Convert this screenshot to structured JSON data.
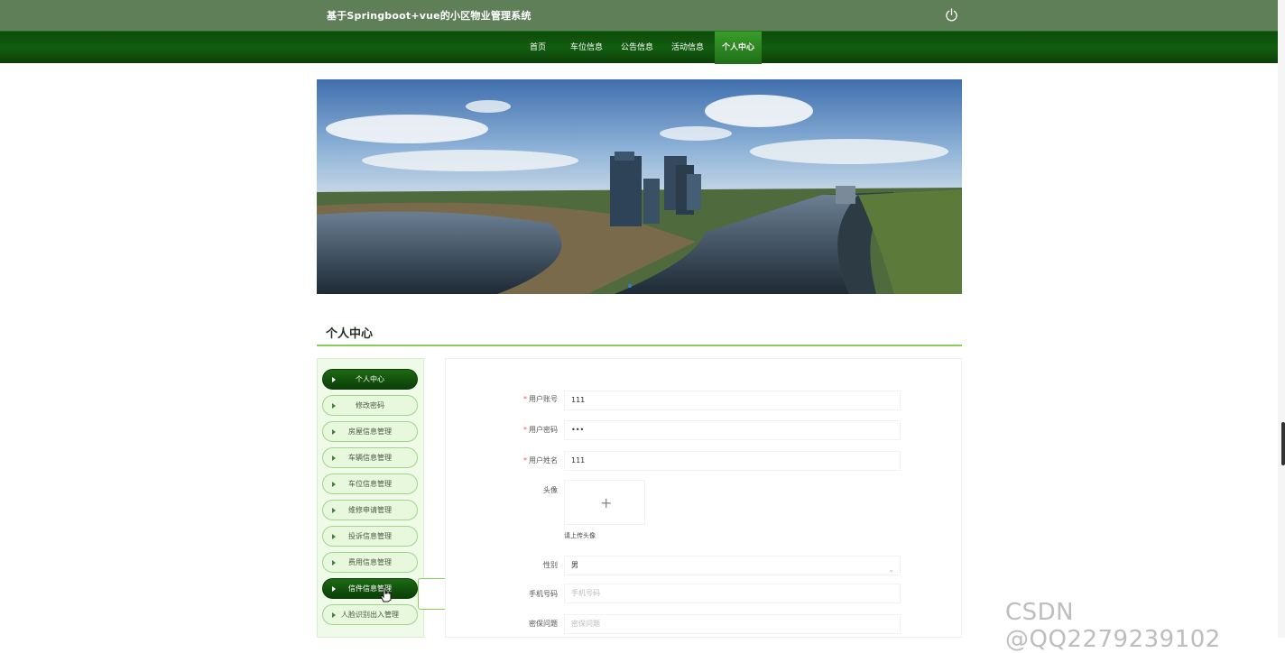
{
  "header": {
    "title": "基于Springboot+vue的小区物业管理系统",
    "power_icon": "power-icon"
  },
  "nav": {
    "items": [
      {
        "label": "首页"
      },
      {
        "label": "车位信息"
      },
      {
        "label": "公告信息"
      },
      {
        "label": "活动信息"
      },
      {
        "label": "个人中心"
      }
    ],
    "active": "个人中心"
  },
  "banner": {
    "image": "city-panorama-river"
  },
  "section": {
    "title": "个人中心"
  },
  "sidebar": {
    "items": [
      {
        "label": "个人中心"
      },
      {
        "label": "修改密码"
      },
      {
        "label": "房屋信息管理"
      },
      {
        "label": "车辆信息管理"
      },
      {
        "label": "车位信息管理"
      },
      {
        "label": "维修申请管理"
      },
      {
        "label": "投诉信息管理"
      },
      {
        "label": "费用信息管理"
      },
      {
        "label": "信件信息管理"
      },
      {
        "label": "人脸识别出入管理"
      }
    ],
    "dropdown": {
      "label": "信件信息"
    }
  },
  "form": {
    "account_label": "用户账号",
    "account_value": "111",
    "password_label": "用户密码",
    "password_value": "•••",
    "name_label": "用户姓名",
    "name_value": "111",
    "avatar_label": "头像",
    "avatar_hint": "请上传头像",
    "gender_label": "性别",
    "gender_value": "男",
    "phone_label": "手机号码",
    "phone_placeholder": "手机号码",
    "security_label": "密保问题",
    "security_placeholder": "密保问题",
    "required_mark": "*"
  },
  "watermark": "CSDN @QQ2279239102",
  "colors": {
    "topbar": "#5f7f59",
    "nav": "#125e10",
    "accent": "#8ccc5c"
  }
}
